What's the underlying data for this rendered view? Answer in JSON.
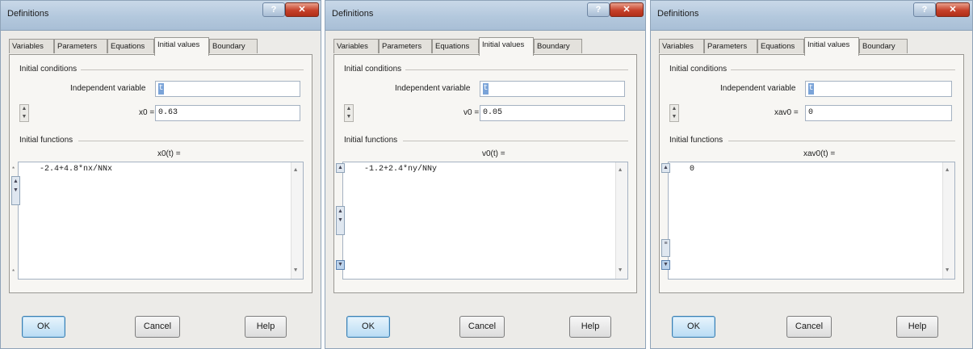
{
  "dialogs": [
    {
      "title": "Definitions",
      "tabs": [
        "Variables",
        "Parameters",
        "Equations",
        "Initial values",
        "Boundary"
      ],
      "active_tab": "Initial values",
      "initial_conditions_label": "Initial conditions",
      "independent_variable_label": "Independent variable",
      "independent_variable_value": "t",
      "init_label": "x0 =",
      "init_value": "0.63",
      "initial_functions_label": "Initial functions",
      "function_label": "x0(t) =",
      "function_text": "-2.4+4.8*nx/NNx",
      "buttons": {
        "ok": "OK",
        "cancel": "Cancel",
        "help": "Help"
      }
    },
    {
      "title": "Definitions",
      "tabs": [
        "Variables",
        "Parameters",
        "Equations",
        "Initial values",
        "Boundary"
      ],
      "active_tab": "Initial values",
      "initial_conditions_label": "Initial conditions",
      "independent_variable_label": "Independent variable",
      "independent_variable_value": "t",
      "init_label": "v0 =",
      "init_value": "0.05",
      "initial_functions_label": "Initial functions",
      "function_label": "v0(t) =",
      "function_text": "-1.2+2.4*ny/NNy",
      "buttons": {
        "ok": "OK",
        "cancel": "Cancel",
        "help": "Help"
      }
    },
    {
      "title": "Definitions",
      "tabs": [
        "Variables",
        "Parameters",
        "Equations",
        "Initial values",
        "Boundary"
      ],
      "active_tab": "Initial values",
      "initial_conditions_label": "Initial conditions",
      "independent_variable_label": "Independent variable",
      "independent_variable_value": "t",
      "init_label": "xav0 =",
      "init_value": "0",
      "initial_functions_label": "Initial functions",
      "function_label": "xav0(t) =",
      "function_text": "0",
      "buttons": {
        "ok": "OK",
        "cancel": "Cancel",
        "help": "Help"
      }
    }
  ],
  "icons": {
    "help": "question-icon",
    "close": "close-x-icon",
    "spin_up": "up-arrow-icon",
    "spin_down": "down-arrow-icon"
  },
  "colors": {
    "title_bar": "#b3c8dd",
    "close_button": "#c6412a",
    "ok_button": "#b9dcf4",
    "dialog_bg": "#ecebe8"
  }
}
